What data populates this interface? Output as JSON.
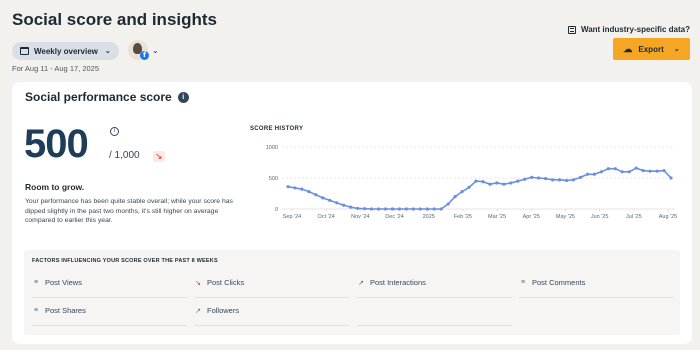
{
  "header": {
    "title": "Social score and insights",
    "period_label": "Weekly overview",
    "date_range": "For Aug 11 - Aug 17, 2025",
    "industry_link": "Want industry-specific data?",
    "export_label": "Export",
    "profile_badge": "f"
  },
  "score_card": {
    "title": "Social performance score",
    "info_glyph": "i",
    "score": "500",
    "score_max": "/ 1,000",
    "trend_glyph": "↘",
    "heading": "Room to grow.",
    "description": "Your performance has been quite stable overall; while your score has dipped slightly in the past two months, it's still higher on average compared to earlier this year."
  },
  "chart_data": {
    "type": "line",
    "title": "SCORE HISTORY",
    "xlabel": "",
    "ylabel": "",
    "ylim": [
      0,
      1000
    ],
    "yticks": [
      0,
      500,
      1000
    ],
    "grid": true,
    "color": "#6b8fe0",
    "x_tick_labels": [
      "Sep '24",
      "Oct '24",
      "Nov '24",
      "Dec '24",
      "2025",
      "Feb '25",
      "Mar '25",
      "Apr '25",
      "May '25",
      "Jun '25",
      "Jul '25",
      "Aug '25"
    ],
    "series": [
      {
        "values": [
          360,
          340,
          320,
          280,
          230,
          180,
          140,
          100,
          60,
          30,
          10,
          5,
          0,
          0,
          0,
          0,
          0,
          0,
          0,
          0,
          0,
          0,
          0,
          80,
          200,
          280,
          350,
          450,
          440,
          400,
          420,
          400,
          420,
          450,
          480,
          510,
          500,
          490,
          470,
          470,
          460,
          470,
          510,
          560,
          560,
          600,
          650,
          650,
          600,
          600,
          660,
          620,
          610,
          610,
          620,
          500
        ]
      }
    ]
  },
  "factors": {
    "title": "FACTORS INFLUENCING YOUR SCORE OVER THE PAST 8 WEEKS",
    "items": [
      {
        "label": "Post Views",
        "glyph": "≡",
        "trend": "flat"
      },
      {
        "label": "Post Clicks",
        "glyph": "↘",
        "trend": "down"
      },
      {
        "label": "Post Interactions",
        "glyph": "↗",
        "trend": "flat"
      },
      {
        "label": "Post Comments",
        "glyph": "≡",
        "trend": "flat"
      },
      {
        "label": "Post Shares",
        "glyph": "≡",
        "trend": "flat"
      },
      {
        "label": "Followers",
        "glyph": "↗",
        "trend": "up"
      }
    ]
  },
  "colors": {
    "accent": "#f5a623",
    "score_text": "#1d3d59",
    "line": "#6b8fe0",
    "down": "#c0392b",
    "up": "#2e9b4f"
  }
}
